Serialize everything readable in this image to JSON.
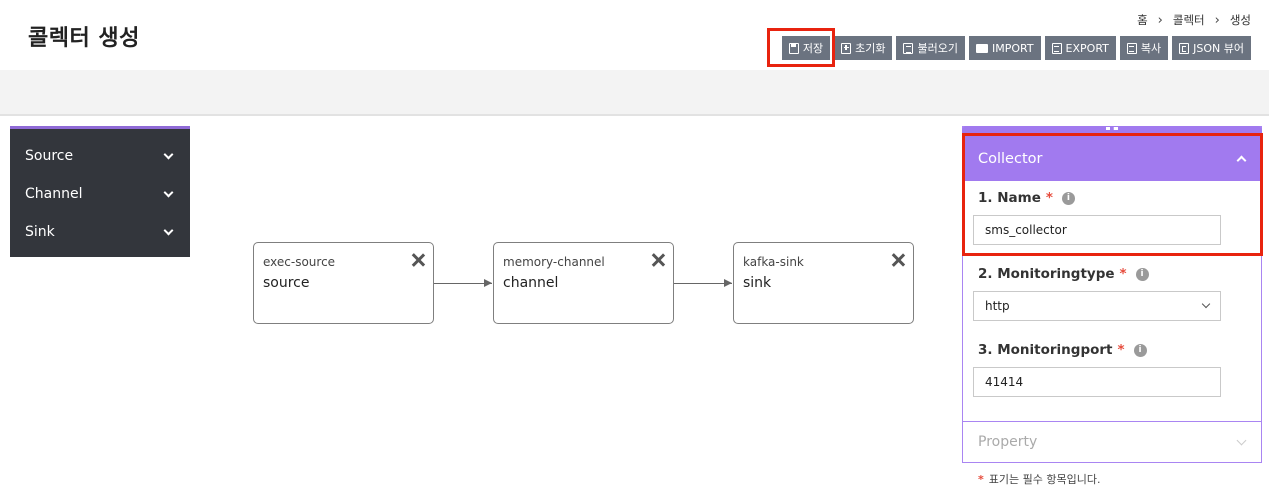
{
  "page": {
    "title": "콜렉터 생성"
  },
  "breadcrumb": [
    "홈",
    "콜렉터",
    "생성"
  ],
  "toolbar": {
    "buttons": [
      {
        "label": "저장",
        "icon": "save-icon"
      },
      {
        "label": "초기화",
        "icon": "plus-square-icon"
      },
      {
        "label": "불러오기",
        "icon": "list-icon"
      },
      {
        "label": "IMPORT",
        "icon": "folder-icon"
      },
      {
        "label": "EXPORT",
        "icon": "document-icon"
      },
      {
        "label": "복사",
        "icon": "copy-icon"
      },
      {
        "label": "JSON 뷰어",
        "icon": "json-icon"
      }
    ]
  },
  "palette": {
    "items": [
      "Source",
      "Channel",
      "Sink"
    ]
  },
  "canvas": {
    "nodes": [
      {
        "type": "exec-source",
        "label": "source"
      },
      {
        "type": "memory-channel",
        "label": "channel"
      },
      {
        "type": "kafka-sink",
        "label": "sink"
      }
    ]
  },
  "panel": {
    "title": "Collector",
    "fields": [
      {
        "label": "1. Name",
        "required": "*",
        "value": "sms_collector"
      },
      {
        "label": "2. Monitoringtype",
        "required": "*",
        "value": "http"
      },
      {
        "label": "3. Monitoringport",
        "required": "*",
        "value": "41414"
      }
    ],
    "property_label": "Property"
  },
  "footnote": {
    "mark": "*",
    "text": "표기는 필수 항목입니다."
  },
  "colors": {
    "accent": "#a17aef",
    "button": "#6b7380",
    "highlight": "#e8230f",
    "palette_bg": "#33363c"
  }
}
